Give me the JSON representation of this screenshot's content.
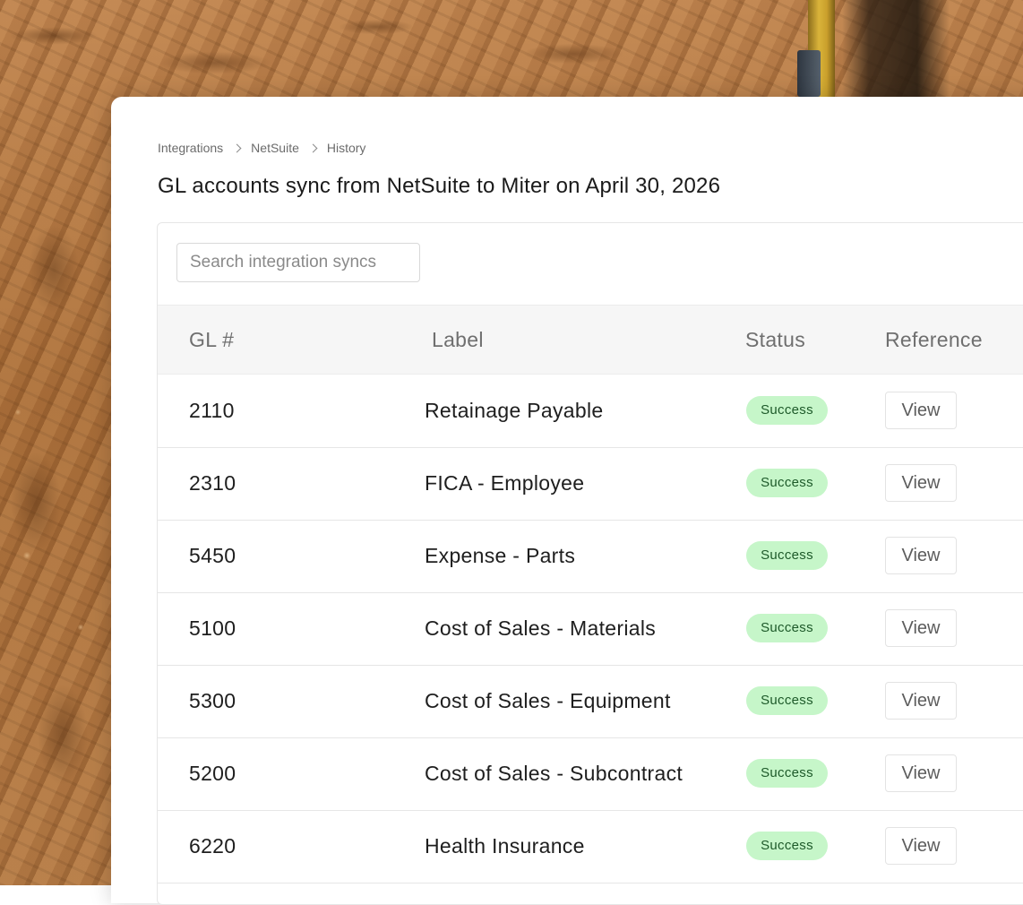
{
  "breadcrumb": {
    "items": [
      "Integrations",
      "NetSuite",
      "History"
    ]
  },
  "page": {
    "title": "GL accounts sync from NetSuite to Miter on April 30, 2026"
  },
  "search": {
    "placeholder": "Search integration syncs"
  },
  "table": {
    "headers": {
      "gl": "GL #",
      "label": "Label",
      "status": "Status",
      "reference": "Reference"
    },
    "rows": [
      {
        "gl": "2110",
        "label": "Retainage Payable",
        "status": "Success",
        "reference": "View"
      },
      {
        "gl": "2310",
        "label": "FICA - Employee",
        "status": "Success",
        "reference": "View"
      },
      {
        "gl": "5450",
        "label": "Expense - Parts",
        "status": "Success",
        "reference": "View"
      },
      {
        "gl": "5100",
        "label": "Cost of Sales - Materials",
        "status": "Success",
        "reference": "View"
      },
      {
        "gl": "5300",
        "label": "Cost of Sales - Equipment",
        "status": "Success",
        "reference": "View"
      },
      {
        "gl": "5200",
        "label": "Cost of Sales - Subcontract",
        "status": "Success",
        "reference": "View"
      },
      {
        "gl": "6220",
        "label": "Health Insurance",
        "status": "Success",
        "reference": "View"
      }
    ]
  },
  "colors": {
    "success_bg": "#c6f6c9",
    "success_text": "#1e5a2a",
    "header_bg": "#f6f6f6"
  }
}
